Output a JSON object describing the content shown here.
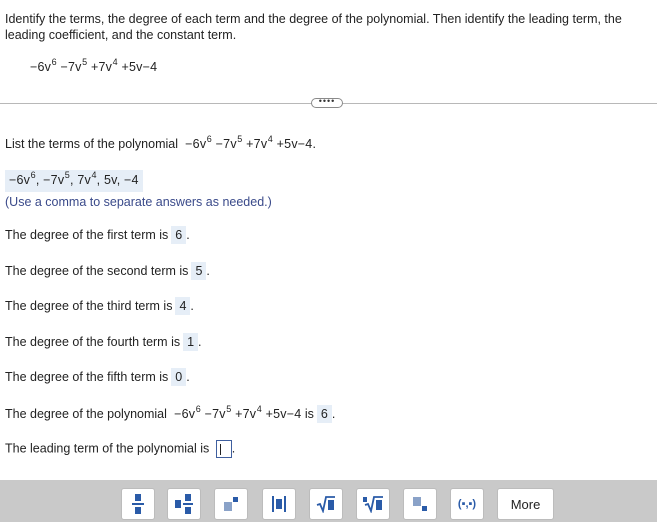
{
  "question": {
    "instruction": "Identify the terms, the degree of each term and the degree of the polynomial. Then identify the leading term, the leading coefficient, and the constant term.",
    "polynomial": {
      "t1": "−6v",
      "e1": "6",
      "t2": " −7v",
      "e2": "5",
      "t3": " +7v",
      "e3": "4",
      "t4": " +5v−4"
    }
  },
  "more_label": "••••",
  "steps": {
    "list_terms_prompt": "List the terms of the polynomial",
    "list_terms_suffix": ".",
    "terms_answer": {
      "a": "−6v",
      "ae": "6",
      "b": ", −7v",
      "be": "5",
      "c": ", 7v",
      "ce": "4",
      "d": ", 5v, −4"
    },
    "hint": "(Use a comma to separate answers as needed.)",
    "first": {
      "prompt": "The degree of the first term is",
      "answer": "6"
    },
    "second": {
      "prompt": "The degree of the second term is",
      "answer": "5"
    },
    "third": {
      "prompt": "The degree of the third term is",
      "answer": "4"
    },
    "fourth": {
      "prompt": "The degree of the fourth term is",
      "answer": "1"
    },
    "fifth": {
      "prompt": "The degree of the fifth term is",
      "answer": "0"
    },
    "poly_degree": {
      "prompt": "The degree of the polynomial",
      "is": "is",
      "answer": "6"
    },
    "leading_term": {
      "prompt": "The leading term of the polynomial is",
      "value": ""
    },
    "period": "."
  },
  "toolbar": {
    "tools": [
      "fraction",
      "mixed-number",
      "exponent",
      "absolute-value",
      "square-root",
      "nth-root",
      "subscript",
      "ordered-pair"
    ],
    "ordered_pair_label": "(▪,▪)",
    "more_label": "More"
  }
}
